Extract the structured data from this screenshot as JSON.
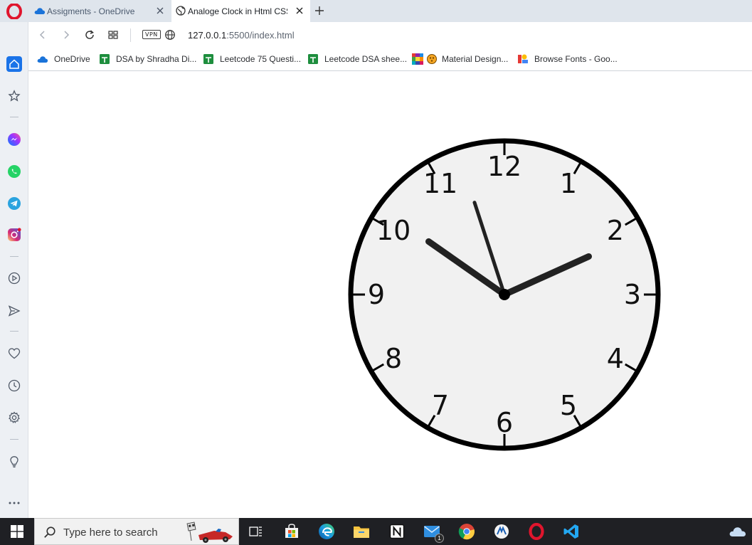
{
  "browser": {
    "tabs": [
      {
        "title": "Assigments - OneDrive",
        "active": false
      },
      {
        "title": "Analoge Clock in Html CSS",
        "active": true
      }
    ],
    "address": {
      "host": "127.0.0.1",
      "rest": ":5500/index.html"
    },
    "vpn_label": "VPN",
    "bookmarks": [
      {
        "label": "OneDrive",
        "icon": "onedrive-icon"
      },
      {
        "label": "DSA by Shradha Di...",
        "icon": "sheets-icon"
      },
      {
        "label": "Leetcode 75 Questi...",
        "icon": "sheets-icon"
      },
      {
        "label": "Leetcode DSA shee...",
        "icon": "sheets-icon"
      },
      {
        "label": "Material Design...",
        "icon": "material-icon"
      },
      {
        "label": "Browse Fonts - Goo...",
        "icon": "google-fonts-icon"
      }
    ]
  },
  "clock": {
    "numerals": [
      "12",
      "1",
      "2",
      "3",
      "4",
      "5",
      "6",
      "7",
      "8",
      "9",
      "10",
      "11"
    ],
    "hour": 10,
    "minute": 10,
    "second": 57,
    "face_color": "#f1f1f1",
    "border_color": "#000000",
    "hand_color": "#222222"
  },
  "taskbar": {
    "search_placeholder": "Type here to search",
    "mail_badge": "1"
  }
}
